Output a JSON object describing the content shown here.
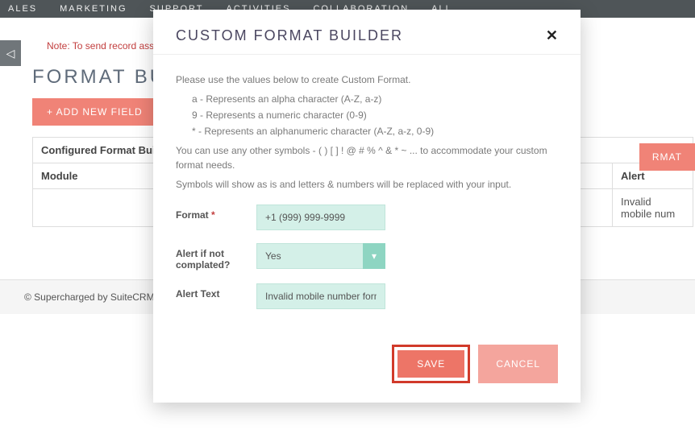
{
  "nav": {
    "items": [
      "ALES",
      "MARKETING",
      "SUPPORT",
      "ACTIVITIES",
      "COLLABORATION",
      "ALL"
    ]
  },
  "sideTabGlyph": "◁",
  "note": "Note: To send record assignm",
  "page_title": "FORMAT BU",
  "add_btn": "+ ADD NEW FIELD",
  "rmat_btn": "RMAT",
  "table": {
    "header_main": "Configured Format Builde",
    "col_module": "Module",
    "col_alert": "Alert",
    "row_alert_value": "Invalid mobile num"
  },
  "footer": "© Supercharged by SuiteCRM    © P",
  "modal": {
    "title": "CUSTOM FORMAT BUILDER",
    "close": "✕",
    "intro": "Please use the values below to create Custom Format.",
    "legend": [
      "a - Represents an alpha character (A-Z, a-z)",
      "9 - Represents a numeric character (0-9)",
      "* - Represents an alphanumeric character (A-Z, a-z, 0-9)"
    ],
    "note2a": "You can use any other symbols - ( ) [ ] ! @ # % ^ & * ~ ... to accommodate your custom format needs.",
    "note2b": "Symbols will show as is and letters & numbers will be replaced with your input.",
    "format_label": "Format",
    "format_value": "+1 (999) 999-9999",
    "alert_if_label_a": "Alert if not",
    "alert_if_label_b": "complated?",
    "alert_if_value": "Yes",
    "alert_text_label": "Alert Text",
    "alert_text_value": "Invalid mobile number format",
    "save": "SAVE",
    "cancel": "CANCEL"
  }
}
